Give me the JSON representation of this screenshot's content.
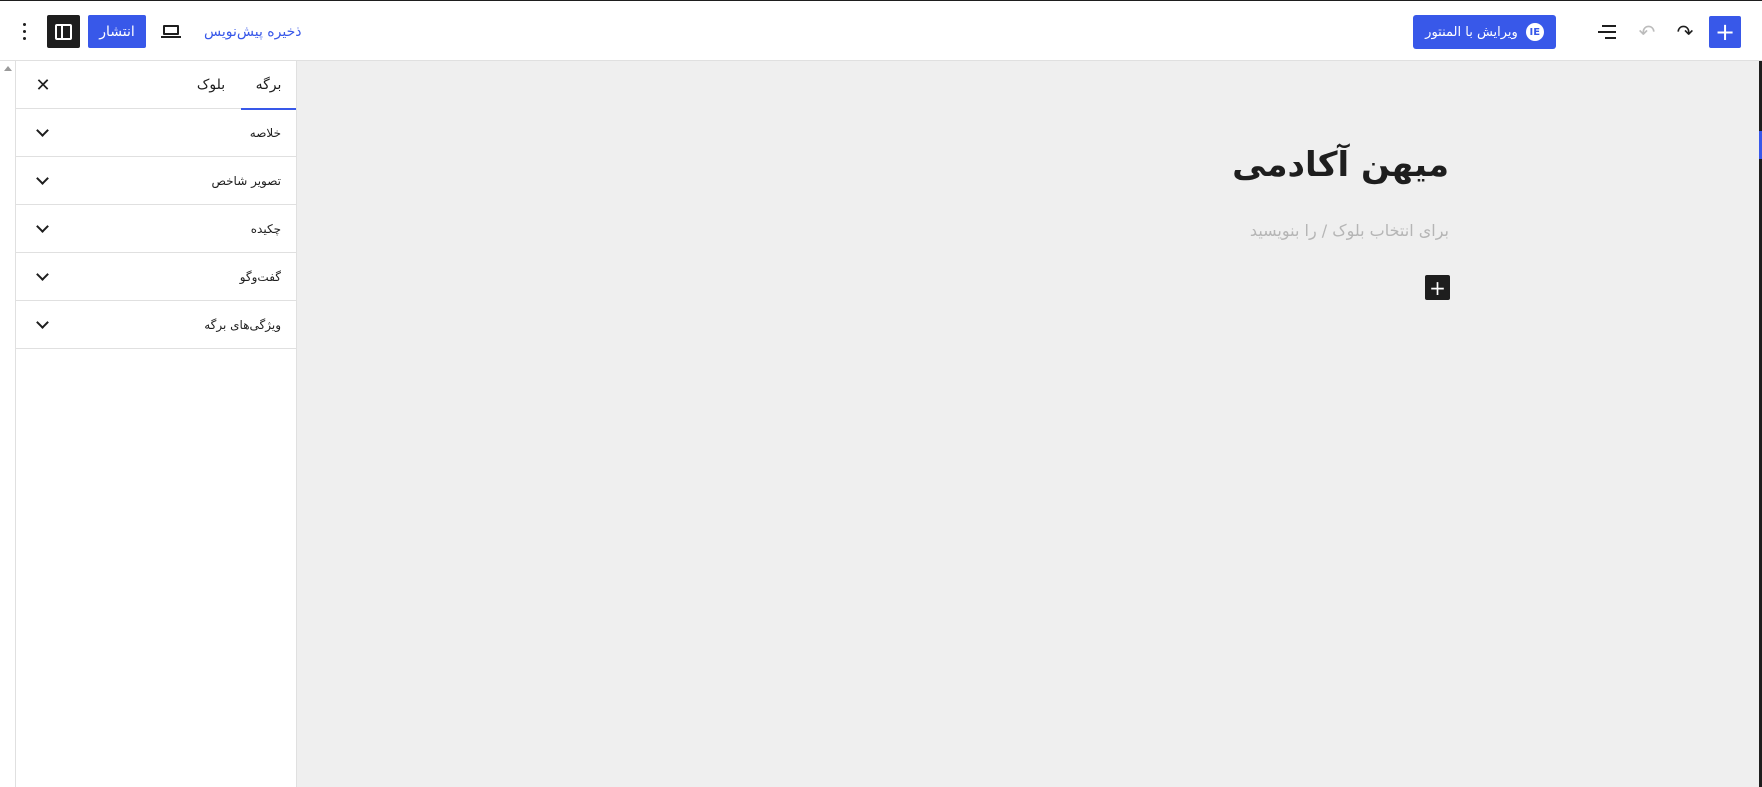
{
  "topbar": {
    "options_icon": "more-vertical-icon",
    "sidebar_toggle_icon": "sidebar-icon",
    "publish_label": "انتشار",
    "preview_icon": "laptop-icon",
    "save_draft_label": "ذخیره پیش‌نویس",
    "elementor_label": "ویرایش با المنتور",
    "elementor_badge": "IE",
    "list_view_icon": "list-view-icon",
    "undo_icon": "undo-icon",
    "redo_icon": "redo-icon",
    "add_block_icon": "plus-icon",
    "accent_color": "#3858e9"
  },
  "sidebar": {
    "tabs": [
      {
        "label": "برگه",
        "active": true
      },
      {
        "label": "بلوک",
        "active": false
      }
    ],
    "close_icon": "close-icon",
    "panels": [
      {
        "title": "خلاصه"
      },
      {
        "title": "تصویر شاخص"
      },
      {
        "title": "چکیده"
      },
      {
        "title": "گفت‌وگو"
      },
      {
        "title": "ویژگی‌های برگه"
      }
    ]
  },
  "canvas": {
    "title": "میهن آکادمی",
    "placeholder": "برای انتخاب بلوک / را بنویسید",
    "inline_add_icon": "plus-icon"
  }
}
